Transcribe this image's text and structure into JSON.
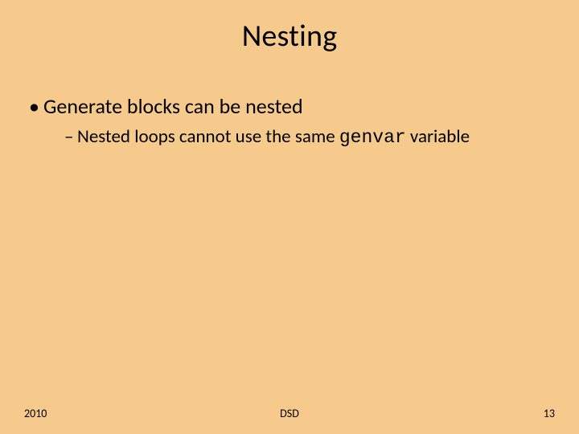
{
  "title": "Nesting",
  "bullets": {
    "lvl1_text": "Generate blocks can be nested",
    "lvl2_prefix": "Nested loops cannot use the same ",
    "lvl2_code": "genvar",
    "lvl2_suffix": "  variable"
  },
  "footer": {
    "left": "2010",
    "center": "DSD",
    "right": "13"
  }
}
